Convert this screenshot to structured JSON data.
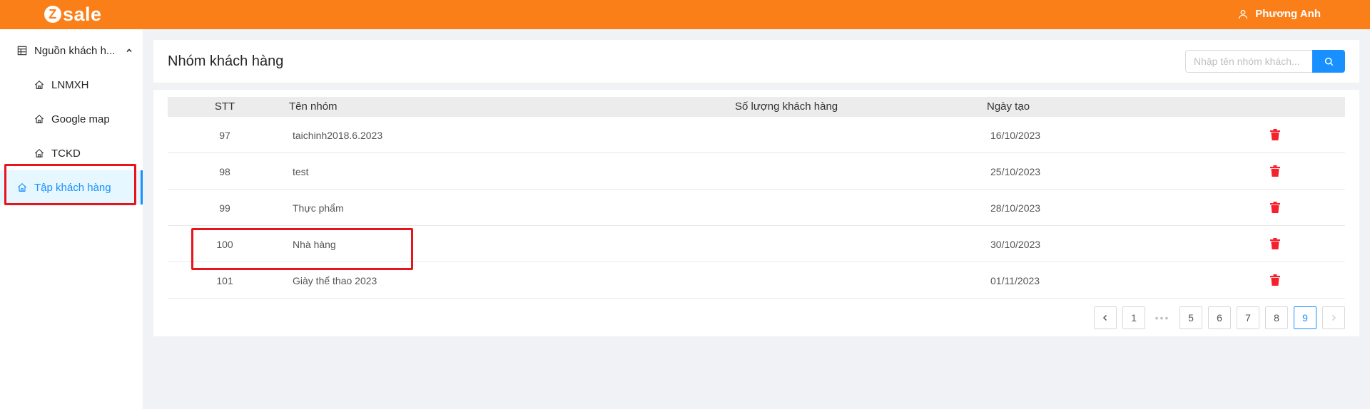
{
  "header": {
    "logo_mark": "Z",
    "logo_text": "sale",
    "user_name": "Phương Anh"
  },
  "sidebar": {
    "parent_label": "Nguồn khách h...",
    "items": [
      {
        "label": "LNMXH"
      },
      {
        "label": "Google map"
      },
      {
        "label": "TCKD"
      },
      {
        "label": "Tập khách hàng"
      }
    ]
  },
  "page": {
    "title": "Nhóm khách hàng",
    "search_placeholder": "Nhập tên nhóm khách..."
  },
  "table": {
    "columns": [
      "STT",
      "Tên nhóm",
      "Số lượng khách hàng",
      "Ngày tạo"
    ],
    "rows": [
      {
        "stt": "97",
        "name": "taichinh2018.6.2023",
        "count": "",
        "date": "16/10/2023"
      },
      {
        "stt": "98",
        "name": "test",
        "count": "",
        "date": "25/10/2023"
      },
      {
        "stt": "99",
        "name": "Thực phẩm",
        "count": "",
        "date": "28/10/2023"
      },
      {
        "stt": "100",
        "name": "Nhà hàng",
        "count": "",
        "date": "30/10/2023"
      },
      {
        "stt": "101",
        "name": "Giày thể thao 2023",
        "count": "",
        "date": "01/11/2023"
      }
    ]
  },
  "pagination": {
    "pages": [
      "1",
      "•••",
      "5",
      "6",
      "7",
      "8",
      "9"
    ],
    "current": "9"
  },
  "colors": {
    "brand_orange": "#fb7f19",
    "accent_blue": "#1890ff",
    "delete_red": "#f5222d",
    "highlight_red": "#e8131b"
  }
}
